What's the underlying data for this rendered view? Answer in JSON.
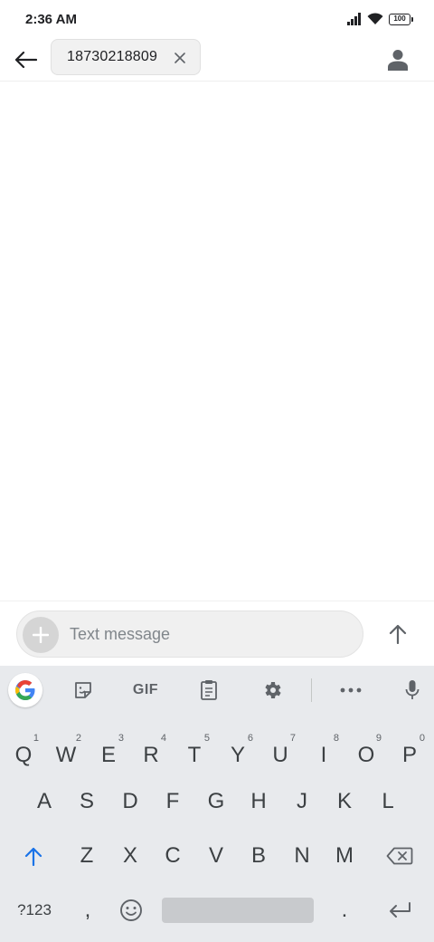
{
  "status_bar": {
    "time": "2:36 AM",
    "battery": "100"
  },
  "header": {
    "recipient": "18730218809"
  },
  "compose": {
    "placeholder": "Text message"
  },
  "keyboard": {
    "toolbar": {
      "gif_label": "GIF"
    },
    "row1": [
      {
        "key": "Q",
        "hint": "1"
      },
      {
        "key": "W",
        "hint": "2"
      },
      {
        "key": "E",
        "hint": "3"
      },
      {
        "key": "R",
        "hint": "4"
      },
      {
        "key": "T",
        "hint": "5"
      },
      {
        "key": "Y",
        "hint": "6"
      },
      {
        "key": "U",
        "hint": "7"
      },
      {
        "key": "I",
        "hint": "8"
      },
      {
        "key": "O",
        "hint": "9"
      },
      {
        "key": "P",
        "hint": "0"
      }
    ],
    "row2": [
      "A",
      "S",
      "D",
      "F",
      "G",
      "H",
      "J",
      "K",
      "L"
    ],
    "row3": [
      "Z",
      "X",
      "C",
      "V",
      "B",
      "N",
      "M"
    ],
    "bottom": {
      "symbols": "?123",
      "comma": ",",
      "period": "."
    }
  }
}
